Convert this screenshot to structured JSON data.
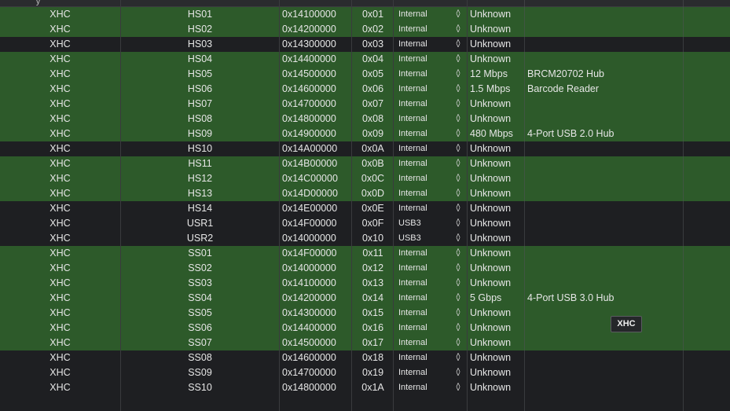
{
  "table": {
    "header": {
      "type": "y",
      "name": "",
      "address": "",
      "port": "",
      "connector": "",
      "speed": "",
      "device": ""
    },
    "rows": [
      {
        "type": "XHC",
        "name": "HS01",
        "address": "0x14100000",
        "port": "0x01",
        "connector": "Internal",
        "speed": "Unknown",
        "device": "",
        "highlight": true
      },
      {
        "type": "XHC",
        "name": "HS02",
        "address": "0x14200000",
        "port": "0x02",
        "connector": "Internal",
        "speed": "Unknown",
        "device": "",
        "highlight": true
      },
      {
        "type": "XHC",
        "name": "HS03",
        "address": "0x14300000",
        "port": "0x03",
        "connector": "Internal",
        "speed": "Unknown",
        "device": "",
        "highlight": false
      },
      {
        "type": "XHC",
        "name": "HS04",
        "address": "0x14400000",
        "port": "0x04",
        "connector": "Internal",
        "speed": "Unknown",
        "device": "",
        "highlight": true
      },
      {
        "type": "XHC",
        "name": "HS05",
        "address": "0x14500000",
        "port": "0x05",
        "connector": "Internal",
        "speed": "12 Mbps",
        "device": "BRCM20702 Hub",
        "highlight": true
      },
      {
        "type": "XHC",
        "name": "HS06",
        "address": "0x14600000",
        "port": "0x06",
        "connector": "Internal",
        "speed": "1.5 Mbps",
        "device": "Barcode Reader",
        "highlight": true
      },
      {
        "type": "XHC",
        "name": "HS07",
        "address": "0x14700000",
        "port": "0x07",
        "connector": "Internal",
        "speed": "Unknown",
        "device": "",
        "highlight": true
      },
      {
        "type": "XHC",
        "name": "HS08",
        "address": "0x14800000",
        "port": "0x08",
        "connector": "Internal",
        "speed": "Unknown",
        "device": "",
        "highlight": true
      },
      {
        "type": "XHC",
        "name": "HS09",
        "address": "0x14900000",
        "port": "0x09",
        "connector": "Internal",
        "speed": "480 Mbps",
        "device": "4-Port USB 2.0 Hub",
        "highlight": true
      },
      {
        "type": "XHC",
        "name": "HS10",
        "address": "0x14A00000",
        "port": "0x0A",
        "connector": "Internal",
        "speed": "Unknown",
        "device": "",
        "highlight": false
      },
      {
        "type": "XHC",
        "name": "HS11",
        "address": "0x14B00000",
        "port": "0x0B",
        "connector": "Internal",
        "speed": "Unknown",
        "device": "",
        "highlight": true
      },
      {
        "type": "XHC",
        "name": "HS12",
        "address": "0x14C00000",
        "port": "0x0C",
        "connector": "Internal",
        "speed": "Unknown",
        "device": "",
        "highlight": true
      },
      {
        "type": "XHC",
        "name": "HS13",
        "address": "0x14D00000",
        "port": "0x0D",
        "connector": "Internal",
        "speed": "Unknown",
        "device": "",
        "highlight": true
      },
      {
        "type": "XHC",
        "name": "HS14",
        "address": "0x14E00000",
        "port": "0x0E",
        "connector": "Internal",
        "speed": "Unknown",
        "device": "",
        "highlight": false
      },
      {
        "type": "XHC",
        "name": "USR1",
        "address": "0x14F00000",
        "port": "0x0F",
        "connector": "USB3",
        "speed": "Unknown",
        "device": "",
        "highlight": false
      },
      {
        "type": "XHC",
        "name": "USR2",
        "address": "0x14000000",
        "port": "0x10",
        "connector": "USB3",
        "speed": "Unknown",
        "device": "",
        "highlight": false
      },
      {
        "type": "XHC",
        "name": "SS01",
        "address": "0x14F00000",
        "port": "0x11",
        "connector": "Internal",
        "speed": "Unknown",
        "device": "",
        "highlight": true
      },
      {
        "type": "XHC",
        "name": "SS02",
        "address": "0x14000000",
        "port": "0x12",
        "connector": "Internal",
        "speed": "Unknown",
        "device": "",
        "highlight": true
      },
      {
        "type": "XHC",
        "name": "SS03",
        "address": "0x14100000",
        "port": "0x13",
        "connector": "Internal",
        "speed": "Unknown",
        "device": "",
        "highlight": true
      },
      {
        "type": "XHC",
        "name": "SS04",
        "address": "0x14200000",
        "port": "0x14",
        "connector": "Internal",
        "speed": "5 Gbps",
        "device": "4-Port USB 3.0 Hub",
        "highlight": true
      },
      {
        "type": "XHC",
        "name": "SS05",
        "address": "0x14300000",
        "port": "0x15",
        "connector": "Internal",
        "speed": "Unknown",
        "device": "",
        "highlight": true
      },
      {
        "type": "XHC",
        "name": "SS06",
        "address": "0x14400000",
        "port": "0x16",
        "connector": "Internal",
        "speed": "Unknown",
        "device": "",
        "highlight": true
      },
      {
        "type": "XHC",
        "name": "SS07",
        "address": "0x14500000",
        "port": "0x17",
        "connector": "Internal",
        "speed": "Unknown",
        "device": "",
        "highlight": true
      },
      {
        "type": "XHC",
        "name": "SS08",
        "address": "0x14600000",
        "port": "0x18",
        "connector": "Internal",
        "speed": "Unknown",
        "device": "",
        "highlight": false
      },
      {
        "type": "XHC",
        "name": "SS09",
        "address": "0x14700000",
        "port": "0x19",
        "connector": "Internal",
        "speed": "Unknown",
        "device": "",
        "highlight": false
      },
      {
        "type": "XHC",
        "name": "SS10",
        "address": "0x14800000",
        "port": "0x1A",
        "connector": "Internal",
        "speed": "Unknown",
        "device": "",
        "highlight": false
      }
    ]
  },
  "tooltip": {
    "text": "XHC"
  },
  "icons": {
    "stepper": "up-down-chevron-icon"
  },
  "colors": {
    "highlight_row": "#2d5a2a",
    "background": "#1e1f22"
  }
}
